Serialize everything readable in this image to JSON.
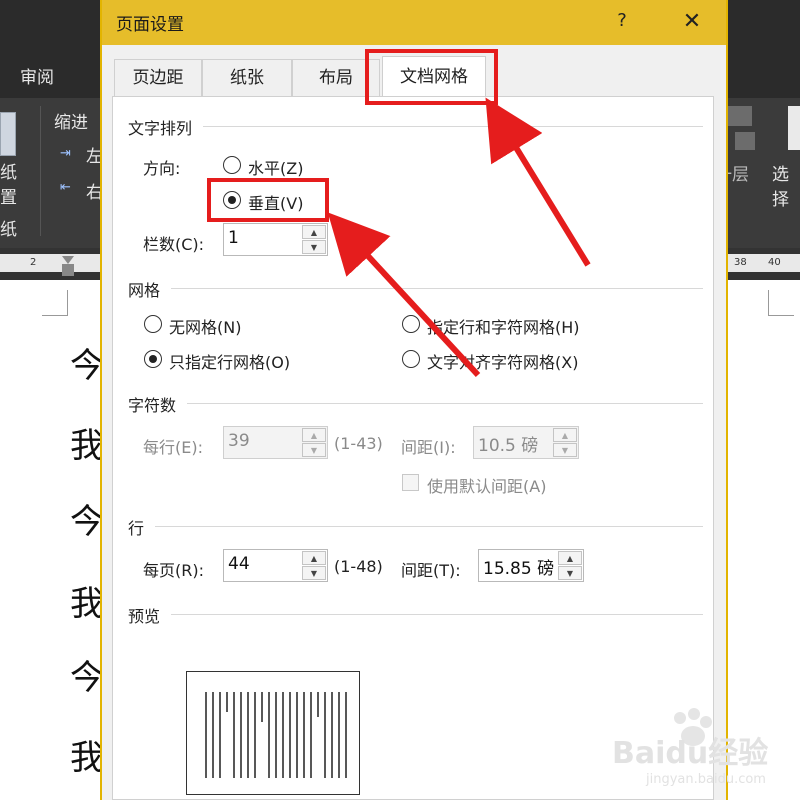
{
  "background": {
    "ribbon_tab_review": "审阅",
    "ribbon_indent_label": "缩进",
    "ribbon_left_label": "左",
    "ribbon_right_label": "右",
    "ribbon_paper_1": "纸",
    "ribbon_paper_2": "置",
    "ribbon_paper_3": "纸",
    "ribbon_layer": "移一层",
    "ribbon_select": "选择",
    "ruler_ticks": [
      "2",
      "38",
      "40"
    ],
    "doc_chars": [
      "今",
      "我",
      "今",
      "我",
      "今",
      "我"
    ]
  },
  "dialog": {
    "title": "页面设置",
    "help": "?",
    "close": "✕",
    "tabs": [
      "页边距",
      "纸张",
      "布局",
      "文档网格"
    ],
    "active_tab": "文档网格",
    "text_direction": {
      "section": "文字排列",
      "direction_label": "方向:",
      "horizontal": "水平(Z)",
      "vertical": "垂直(V)",
      "selected": "vertical",
      "columns_label": "栏数(C):",
      "columns_value": "1"
    },
    "grid": {
      "section": "网格",
      "no_grid": "无网格(N)",
      "specify_line_char": "指定行和字符网格(H)",
      "specify_line_only": "只指定行网格(O)",
      "align_to_char": "文字对齐字符网格(X)",
      "selected": "specify_line_only"
    },
    "characters": {
      "section": "字符数",
      "per_line_label": "每行(E):",
      "per_line_value": "39",
      "per_line_range": "(1-43)",
      "pitch_label": "间距(I):",
      "pitch_value": "10.5 磅",
      "use_default_pitch": "使用默认间距(A)"
    },
    "lines": {
      "section": "行",
      "per_page_label": "每页(R):",
      "per_page_value": "44",
      "per_page_range": "(1-48)",
      "pitch_label": "间距(T):",
      "pitch_value": "15.85 磅"
    },
    "preview": {
      "section": "预览"
    }
  },
  "watermark": {
    "brand": "Baidu经验",
    "url": "jingyan.baidu.com"
  },
  "colors": {
    "titlebar": "#e6bd2a",
    "annotation_red": "#e51d1d"
  }
}
